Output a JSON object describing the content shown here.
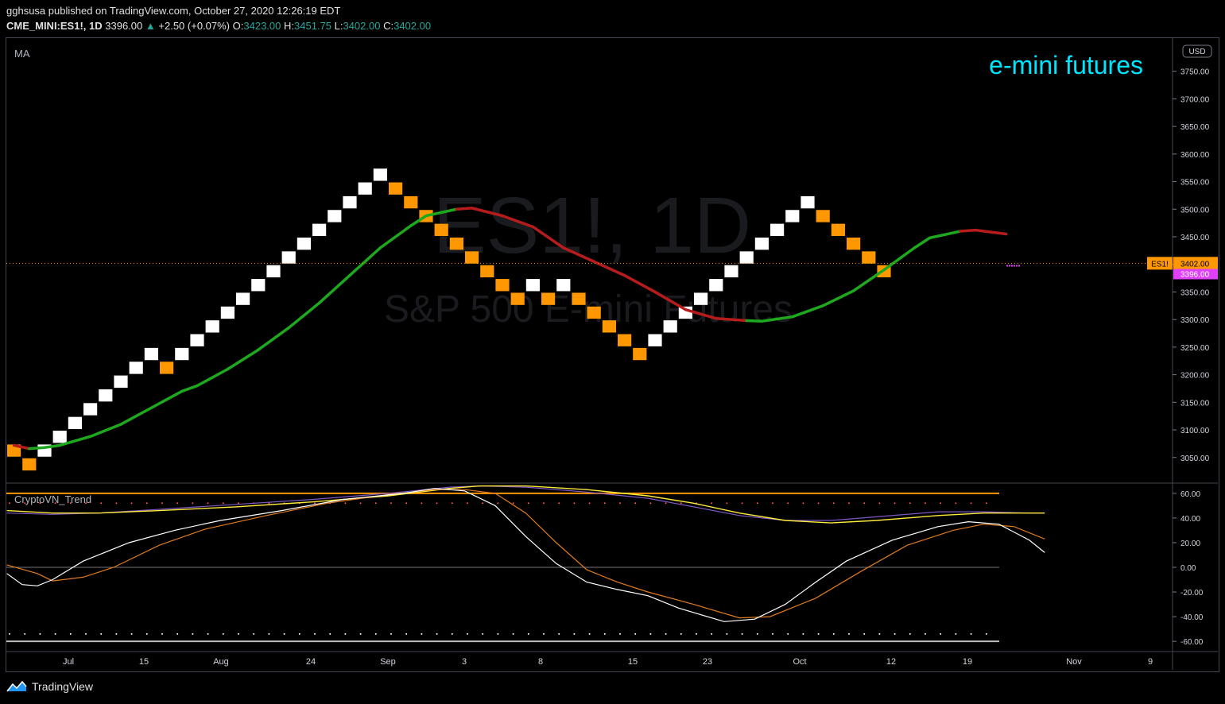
{
  "header": {
    "publisher_line": "gghsusa published on TradingView.com, October 27, 2020 12:26:19 EDT",
    "symbol": "CME_MINI:ES1!, 1D",
    "last": "3396.00",
    "change": "+2.50 (+0.07%)",
    "o_label": "O:",
    "o_value": "3423.00",
    "h_label": "H:",
    "h_value": "3451.75",
    "l_label": "L:",
    "l_value": "3402.00",
    "c_label": "C:",
    "c_value": "3402.00"
  },
  "main_pane": {
    "indicator_label": "MA",
    "annotation": "e-mini futures",
    "watermark_symbol": "ES1!, 1D",
    "watermark_desc": "S&P 500 E-mini Futures",
    "currency": "USD",
    "symbol_tag": "ES1!",
    "price_tag": "3402.00",
    "last_tag": "3396.00"
  },
  "sub_pane": {
    "indicator_label": "CryptoVN_Trend"
  },
  "footer": {
    "brand": "TradingView"
  },
  "colors": {
    "up_brick": "#ffffff",
    "down_brick": "#ff9800",
    "ma_up": "#089981",
    "ma_up_line": "#1ea81e",
    "ma_down": "#b71c1c",
    "annotation": "#00e5ff",
    "level": "#ff9800",
    "osc_fast": "#ffffff",
    "osc_slow": "#e07b20",
    "osc_long": "#ffeb3b",
    "osc_long2": "#7e57c2"
  },
  "chart_data": [
    {
      "type": "renko",
      "title": "CME_MINI:ES1!, 1D",
      "y_axis_ticks": [
        3050,
        3100,
        3150,
        3200,
        3250,
        3300,
        3350,
        3400,
        3450,
        3500,
        3550,
        3600,
        3650,
        3700,
        3750
      ],
      "y_axis_labels": [
        "3050.00",
        "3100.00",
        "3150.00",
        "3200.00",
        "3250.00",
        "3300.00",
        "3350.00",
        "3400.00",
        "3450.00",
        "3500.00",
        "3550.00",
        "3600.00",
        "3650.00",
        "3700.00",
        "3750.00"
      ],
      "ylim": [
        3005,
        3810
      ],
      "x_axis_labels": [
        "Jul",
        "15",
        "Aug",
        "24",
        "Sep",
        "3",
        "8",
        "15",
        "23",
        "Oct",
        "12",
        "19",
        "Nov",
        "9"
      ],
      "brick_size": 25,
      "bricks": [
        {
          "low": 3050,
          "dir": "down"
        },
        {
          "low": 3025,
          "dir": "down"
        },
        {
          "low": 3050,
          "dir": "up"
        },
        {
          "low": 3075,
          "dir": "up"
        },
        {
          "low": 3100,
          "dir": "up"
        },
        {
          "low": 3125,
          "dir": "up"
        },
        {
          "low": 3150,
          "dir": "up"
        },
        {
          "low": 3175,
          "dir": "up"
        },
        {
          "low": 3200,
          "dir": "up"
        },
        {
          "low": 3225,
          "dir": "up"
        },
        {
          "low": 3200,
          "dir": "down"
        },
        {
          "low": 3225,
          "dir": "up"
        },
        {
          "low": 3250,
          "dir": "up"
        },
        {
          "low": 3275,
          "dir": "up"
        },
        {
          "low": 3300,
          "dir": "up"
        },
        {
          "low": 3325,
          "dir": "up"
        },
        {
          "low": 3350,
          "dir": "up"
        },
        {
          "low": 3375,
          "dir": "up"
        },
        {
          "low": 3400,
          "dir": "up"
        },
        {
          "low": 3425,
          "dir": "up"
        },
        {
          "low": 3450,
          "dir": "up"
        },
        {
          "low": 3475,
          "dir": "up"
        },
        {
          "low": 3500,
          "dir": "up"
        },
        {
          "low": 3525,
          "dir": "up"
        },
        {
          "low": 3550,
          "dir": "up"
        },
        {
          "low": 3525,
          "dir": "down"
        },
        {
          "low": 3500,
          "dir": "down"
        },
        {
          "low": 3475,
          "dir": "down"
        },
        {
          "low": 3450,
          "dir": "down"
        },
        {
          "low": 3425,
          "dir": "down"
        },
        {
          "low": 3400,
          "dir": "down"
        },
        {
          "low": 3375,
          "dir": "down"
        },
        {
          "low": 3350,
          "dir": "down"
        },
        {
          "low": 3325,
          "dir": "down"
        },
        {
          "low": 3350,
          "dir": "up"
        },
        {
          "low": 3325,
          "dir": "down"
        },
        {
          "low": 3350,
          "dir": "up"
        },
        {
          "low": 3325,
          "dir": "down"
        },
        {
          "low": 3300,
          "dir": "down"
        },
        {
          "low": 3275,
          "dir": "down"
        },
        {
          "low": 3250,
          "dir": "down"
        },
        {
          "low": 3225,
          "dir": "down"
        },
        {
          "low": 3250,
          "dir": "up"
        },
        {
          "low": 3275,
          "dir": "up"
        },
        {
          "low": 3300,
          "dir": "up"
        },
        {
          "low": 3325,
          "dir": "up"
        },
        {
          "low": 3350,
          "dir": "up"
        },
        {
          "low": 3375,
          "dir": "up"
        },
        {
          "low": 3400,
          "dir": "up"
        },
        {
          "low": 3425,
          "dir": "up"
        },
        {
          "low": 3450,
          "dir": "up"
        },
        {
          "low": 3475,
          "dir": "up"
        },
        {
          "low": 3500,
          "dir": "up"
        },
        {
          "low": 3475,
          "dir": "down"
        },
        {
          "low": 3450,
          "dir": "down"
        },
        {
          "low": 3425,
          "dir": "down"
        },
        {
          "low": 3400,
          "dir": "down"
        },
        {
          "low": 3375,
          "dir": "down"
        }
      ],
      "moving_average": [
        {
          "i": 0,
          "v": 3072,
          "c": "down"
        },
        {
          "i": 1,
          "v": 3066,
          "c": "down"
        },
        {
          "i": 2,
          "v": 3068,
          "c": "up"
        },
        {
          "i": 3,
          "v": 3072,
          "c": "up"
        },
        {
          "i": 5,
          "v": 3088,
          "c": "up"
        },
        {
          "i": 7,
          "v": 3110,
          "c": "up"
        },
        {
          "i": 9,
          "v": 3140,
          "c": "up"
        },
        {
          "i": 11,
          "v": 3170,
          "c": "up"
        },
        {
          "i": 12,
          "v": 3180,
          "c": "up"
        },
        {
          "i": 14,
          "v": 3210,
          "c": "up"
        },
        {
          "i": 16,
          "v": 3245,
          "c": "up"
        },
        {
          "i": 18,
          "v": 3285,
          "c": "up"
        },
        {
          "i": 20,
          "v": 3330,
          "c": "up"
        },
        {
          "i": 22,
          "v": 3380,
          "c": "up"
        },
        {
          "i": 24,
          "v": 3430,
          "c": "up"
        },
        {
          "i": 26,
          "v": 3470,
          "c": "up"
        },
        {
          "i": 27,
          "v": 3488,
          "c": "up"
        },
        {
          "i": 29,
          "v": 3500,
          "c": "up"
        },
        {
          "i": 30,
          "v": 3502,
          "c": "down"
        },
        {
          "i": 32,
          "v": 3488,
          "c": "down"
        },
        {
          "i": 34,
          "v": 3468,
          "c": "down"
        },
        {
          "i": 36,
          "v": 3430,
          "c": "down"
        },
        {
          "i": 38,
          "v": 3405,
          "c": "down"
        },
        {
          "i": 40,
          "v": 3380,
          "c": "down"
        },
        {
          "i": 42,
          "v": 3350,
          "c": "down"
        },
        {
          "i": 44,
          "v": 3318,
          "c": "down"
        },
        {
          "i": 46,
          "v": 3302,
          "c": "down"
        },
        {
          "i": 48,
          "v": 3298,
          "c": "down"
        },
        {
          "i": 49,
          "v": 3297,
          "c": "up"
        },
        {
          "i": 51,
          "v": 3305,
          "c": "up"
        },
        {
          "i": 53,
          "v": 3325,
          "c": "up"
        },
        {
          "i": 55,
          "v": 3352,
          "c": "up"
        },
        {
          "i": 57,
          "v": 3390,
          "c": "up"
        },
        {
          "i": 59,
          "v": 3430,
          "c": "up"
        },
        {
          "i": 60,
          "v": 3448,
          "c": "up"
        },
        {
          "i": 62,
          "v": 3460,
          "c": "up"
        },
        {
          "i": 63,
          "v": 3462,
          "c": "down"
        },
        {
          "i": 65,
          "v": 3455,
          "c": "down"
        }
      ],
      "last_price": 3402.0,
      "last_quote": 3396.0
    },
    {
      "type": "line",
      "title": "CryptoVN_Trend",
      "y_axis_ticks": [
        -60,
        -40,
        -20,
        0,
        20,
        40,
        60
      ],
      "y_axis_labels": [
        "-60.00",
        "-40.00",
        "-20.00",
        "0.00",
        "20.00",
        "40.00",
        "60.00"
      ],
      "ylim": [
        -67,
        67
      ],
      "levels": [
        60,
        0,
        -60
      ],
      "series": [
        {
          "values": [
            [
              0,
              -5
            ],
            [
              1,
              -14
            ],
            [
              2,
              -15
            ],
            [
              3,
              -10
            ],
            [
              5,
              5
            ],
            [
              8,
              20
            ],
            [
              11,
              30
            ],
            [
              14,
              38
            ],
            [
              18,
              46
            ],
            [
              22,
              55
            ],
            [
              26,
              60
            ],
            [
              28,
              64
            ],
            [
              30,
              62
            ],
            [
              32,
              50
            ],
            [
              34,
              25
            ],
            [
              36,
              3
            ],
            [
              38,
              -12
            ],
            [
              40,
              -18
            ],
            [
              42,
              -23
            ],
            [
              44,
              -33
            ],
            [
              47,
              -44
            ],
            [
              49,
              -42
            ],
            [
              51,
              -30
            ],
            [
              53,
              -12
            ],
            [
              55,
              5
            ],
            [
              58,
              22
            ],
            [
              61,
              33
            ],
            [
              63,
              37
            ],
            [
              65,
              35
            ],
            [
              67,
              22
            ],
            [
              68,
              12
            ]
          ]
        },
        {
          "values": [
            [
              0,
              2
            ],
            [
              2,
              -5
            ],
            [
              3,
              -11
            ],
            [
              5,
              -8
            ],
            [
              7,
              0
            ],
            [
              10,
              18
            ],
            [
              13,
              31
            ],
            [
              17,
              42
            ],
            [
              21,
              52
            ],
            [
              25,
              59
            ],
            [
              28,
              63
            ],
            [
              30,
              63
            ],
            [
              32,
              60
            ],
            [
              34,
              44
            ],
            [
              36,
              20
            ],
            [
              38,
              -2
            ],
            [
              40,
              -12
            ],
            [
              42,
              -20
            ],
            [
              45,
              -30
            ],
            [
              48,
              -41
            ],
            [
              50,
              -40
            ],
            [
              53,
              -25
            ],
            [
              56,
              -3
            ],
            [
              59,
              18
            ],
            [
              62,
              30
            ],
            [
              64,
              35
            ],
            [
              66,
              33
            ],
            [
              68,
              23
            ]
          ]
        },
        {
          "values": [
            [
              0,
              46
            ],
            [
              3,
              44
            ],
            [
              6,
              44
            ],
            [
              10,
              46
            ],
            [
              15,
              49
            ],
            [
              20,
              53
            ],
            [
              25,
              58
            ],
            [
              29,
              64
            ],
            [
              31,
              66
            ],
            [
              34,
              66
            ],
            [
              38,
              63
            ],
            [
              42,
              58
            ],
            [
              45,
              52
            ],
            [
              48,
              44
            ],
            [
              51,
              38
            ],
            [
              54,
              36
            ],
            [
              57,
              38
            ],
            [
              61,
              42
            ],
            [
              64,
              44
            ],
            [
              67,
              44
            ],
            [
              68,
              44
            ]
          ]
        },
        {
          "values": [
            [
              0,
              44
            ],
            [
              3,
              43
            ],
            [
              6,
              44
            ],
            [
              10,
              47
            ],
            [
              15,
              51
            ],
            [
              20,
              55
            ],
            [
              25,
              60
            ],
            [
              29,
              65
            ],
            [
              31,
              66
            ],
            [
              34,
              65
            ],
            [
              38,
              61
            ],
            [
              42,
              56
            ],
            [
              45,
              49
            ],
            [
              48,
              42
            ],
            [
              51,
              38
            ],
            [
              54,
              38
            ],
            [
              57,
              41
            ],
            [
              61,
              45
            ],
            [
              64,
              45
            ],
            [
              67,
              44
            ],
            [
              68,
              44
            ]
          ]
        }
      ]
    }
  ]
}
